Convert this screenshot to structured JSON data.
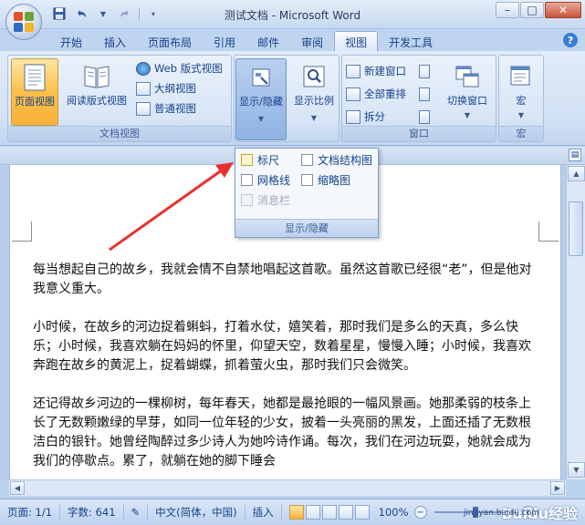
{
  "window": {
    "title": "测试文档 - Microsoft Word",
    "minimize": "–",
    "maximize": "□",
    "close": "✕"
  },
  "qat": {
    "save_icon": "save-icon",
    "undo_icon": "undo-icon",
    "redo_icon": "redo-icon",
    "customize_icon": "chevron-down-icon"
  },
  "tabs": [
    {
      "label": "开始",
      "active": false
    },
    {
      "label": "插入",
      "active": false
    },
    {
      "label": "页面布局",
      "active": false
    },
    {
      "label": "引用",
      "active": false
    },
    {
      "label": "邮件",
      "active": false
    },
    {
      "label": "审阅",
      "active": false
    },
    {
      "label": "视图",
      "active": true
    },
    {
      "label": "开发工具",
      "active": false
    }
  ],
  "ribbon": {
    "document_views": {
      "label": "文档视图",
      "print_layout": "页面视图",
      "reading_layout": "阅读版式视图",
      "web_layout": "Web 版式视图",
      "outline": "大纲视图",
      "draft": "普通视图"
    },
    "show_hide": {
      "label": "显示/隐藏"
    },
    "zoom": {
      "label": "显示比例"
    },
    "window": {
      "label": "窗口",
      "new_window": "新建窗口",
      "arrange_all": "全部重排",
      "split": "拆分",
      "switch_windows": "切换窗口"
    },
    "macros": {
      "label": "宏",
      "button": "宏"
    }
  },
  "show_hide_panel": {
    "ruler": "标尺",
    "document_map": "文档结构图",
    "gridlines": "网格线",
    "thumbnails": "缩略图",
    "message_bar": "消息栏",
    "footer": "显示/隐藏"
  },
  "document": {
    "paragraphs": [
      "每当想起自己的故乡，我就会情不自禁地唱起这首歌。虽然这首歌已经很“老”，但是他对我意义重大。",
      "小时候，在故乡的河边捉着蝌蚪，打着水仗，嬉笑着，那时我们是多么的天真，多么快乐；小时候，我喜欢躺在妈妈的怀里，仰望天空，数着星星，慢慢入睡；小时候，我喜欢奔跑在故乡的黄泥上，捉着蝴蝶，抓着萤火虫，那时我们只会微笑。",
      "还记得故乡河边的一棵柳树，每年春天，她都是最抢眼的一幅风景画。她那柔弱的枝条上长了无数颗嫩绿的早芽，如同一位年轻的少女，披着一头亮丽的黑发，上面还插了无数根洁白的银针。她曾经陶醉过多少诗人为她吟诗作诵。每次，我们在河边玩耍，她就会成为我们的停歇点。累了，就躺在她的脚下睡会"
    ]
  },
  "statusbar": {
    "page": "页面: 1/1",
    "words": "字数: 641",
    "language": "中文(简体，中国)",
    "insert_mode": "插入",
    "zoom": "100%",
    "zoom_minus": "−",
    "zoom_plus": "+"
  },
  "watermark": {
    "brand": "Baidu经验",
    "url": "jingyan.baidu.com"
  },
  "colors": {
    "accent": "#15428b",
    "annotation_arrow": "#e8312f"
  }
}
